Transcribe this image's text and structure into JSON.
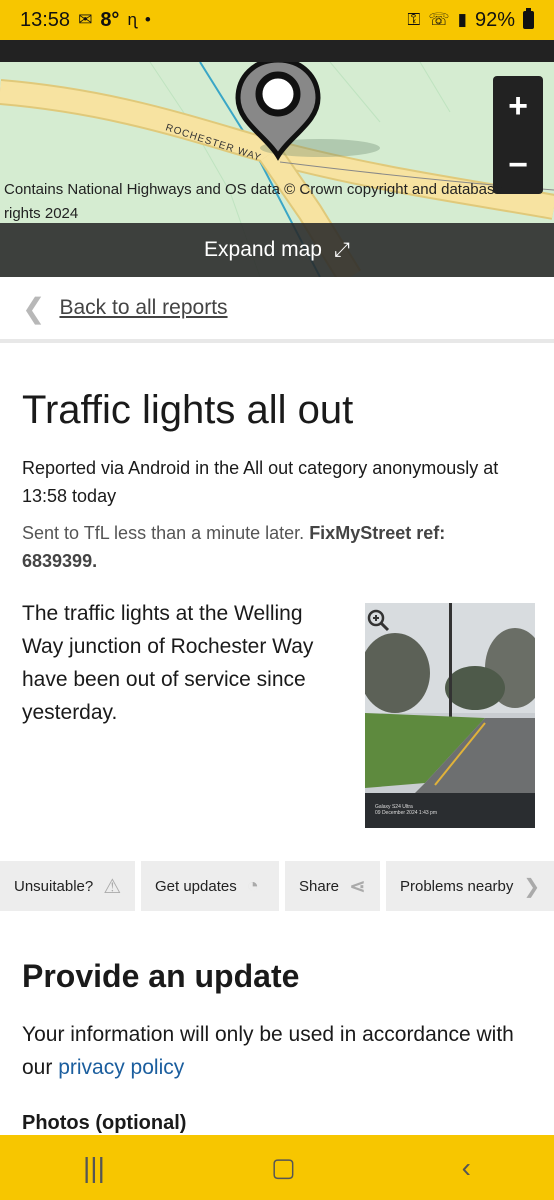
{
  "status": {
    "time": "13:58",
    "temp": "8°",
    "battery": "92%",
    "left_icons": [
      "mail-icon",
      "weather-icon",
      "dot-icon"
    ],
    "right_icons": [
      "key-icon",
      "wifi-call-icon",
      "signal-icon"
    ]
  },
  "map": {
    "road_label": "ROCHESTER WAY",
    "attribution": "Contains National Highways and OS data © Crown copyright and database rights 2024",
    "zoom_in": "+",
    "zoom_out": "−",
    "expand_label": "Expand map"
  },
  "nav": {
    "back_label": "Back to all reports"
  },
  "report": {
    "title": "Traffic lights all out",
    "meta": "Reported via Android in the All out category anonymously at 13:58 today",
    "sent_prefix": "Sent to TfL less than a minute later.",
    "sent_ref": "FixMyStreet ref: 6839399.",
    "description": "The traffic lights at the Welling Way junction of Rochester Way have been out of service since yesterday.",
    "photo_caption_line1": "Galaxy S24 Ultra",
    "photo_caption_line2": "09 December 2024 1:43 pm"
  },
  "actions": [
    {
      "label": "Unsuitable?",
      "icon": "warning-icon"
    },
    {
      "label": "Get updates",
      "icon": "rss-icon"
    },
    {
      "label": "Share",
      "icon": "share-icon"
    },
    {
      "label": "Problems nearby",
      "icon": "chevron-right-icon"
    }
  ],
  "update": {
    "heading": "Provide an update",
    "info_prefix": "Your information will only be used in accordance with our",
    "privacy_link": "privacy policy",
    "photos_label": "Photos (optional)"
  },
  "colors": {
    "accent_yellow": "#f7c600",
    "map_green": "#d5ecd1",
    "link_blue": "#1b5e9e"
  }
}
